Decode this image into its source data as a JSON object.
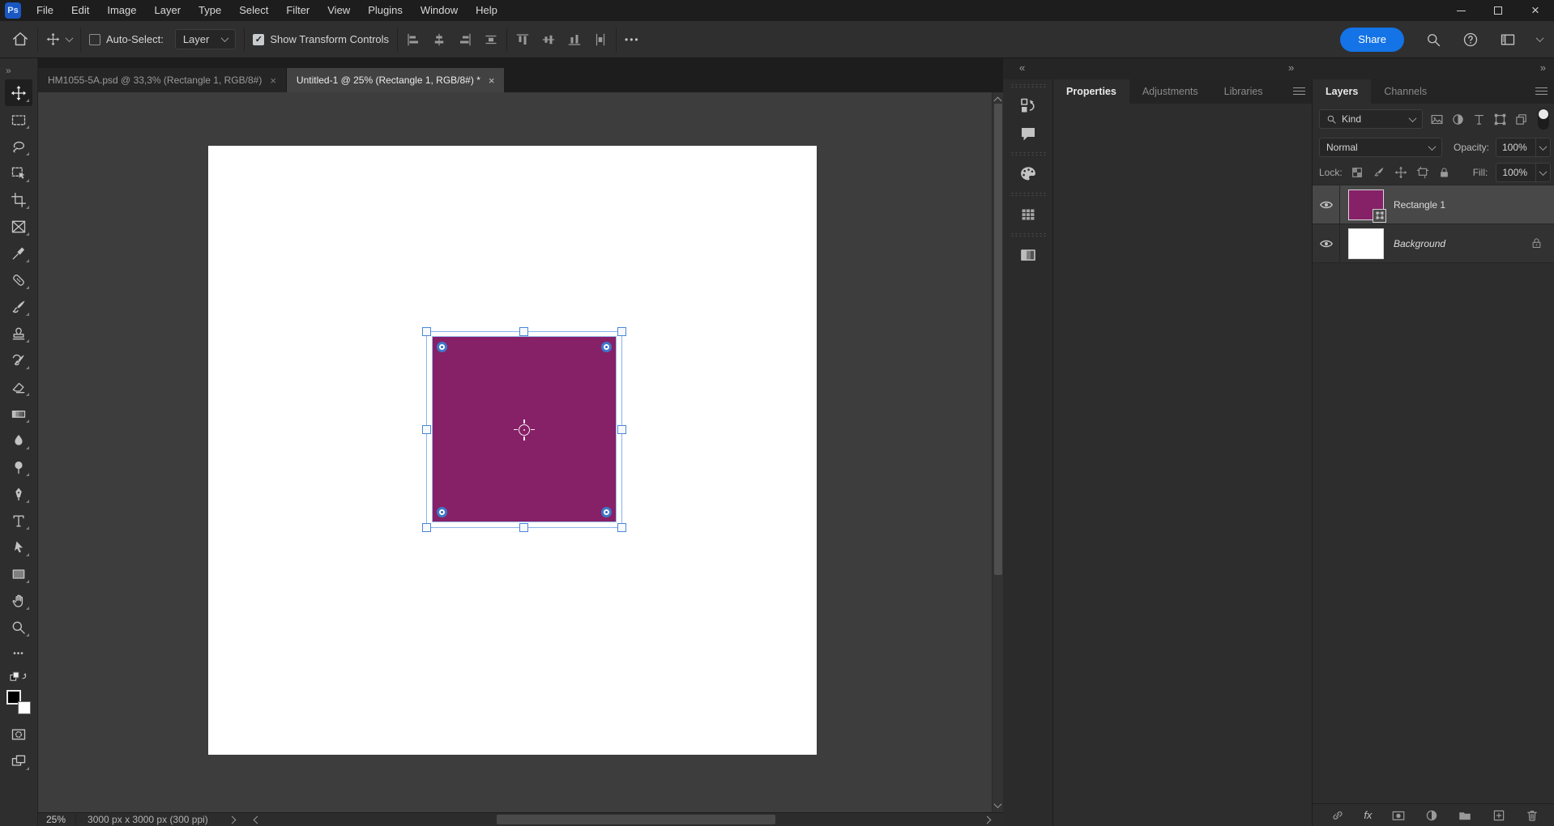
{
  "colors": {
    "accent_blue": "#1473e6",
    "selection_blue": "#4a86d8",
    "shape_fill": "#862067",
    "canvas_surface": "#3d3d3d",
    "panel_background": "#2d2d2d"
  },
  "menubar": {
    "logo": "Ps",
    "items": [
      "File",
      "Edit",
      "Image",
      "Layer",
      "Type",
      "Select",
      "Filter",
      "View",
      "Plugins",
      "Window",
      "Help"
    ]
  },
  "window_controls": [
    "minimize",
    "maximize",
    "close"
  ],
  "options_bar": {
    "auto_select_label": "Auto-Select:",
    "auto_select_checked": false,
    "target_selector_value": "Layer",
    "show_transform_label": "Show Transform Controls",
    "show_transform_checked": true,
    "align_icons": [
      "align-left-edges",
      "align-horizontal-centers",
      "align-right-edges",
      "distribute-horizontal-centers",
      "align-top-edges",
      "align-vertical-centers",
      "align-bottom-edges",
      "distribute-vertical-centers"
    ],
    "share_label": "Share"
  },
  "document_tabs": [
    {
      "label": "HM1055-5A.psd @ 33,3% (Rectangle 1, RGB/8#)",
      "active": false
    },
    {
      "label": "Untitled-1 @ 25% (Rectangle 1, RGB/8#) *",
      "active": true
    }
  ],
  "toolbar_tools": [
    "move",
    "rectangular-marquee",
    "lasso",
    "object-selection",
    "crop",
    "frame",
    "eyedropper",
    "spot-healing-brush",
    "brush",
    "clone-stamp",
    "history-brush",
    "eraser",
    "gradient",
    "blur",
    "dodge",
    "pen",
    "type",
    "path-selection",
    "rectangle",
    "hand",
    "zoom",
    "more-tools",
    "swap-colors",
    "foreground-background-swatches",
    "quick-mask",
    "screen-mode"
  ],
  "collapsed_panel_icons": [
    "history",
    "comments",
    "color",
    "patterns",
    "gradients"
  ],
  "properties_group": {
    "tabs": [
      {
        "label": "Properties",
        "active": true
      },
      {
        "label": "Adjustments",
        "active": false
      },
      {
        "label": "Libraries",
        "active": false
      }
    ]
  },
  "layers_panel": {
    "tabs": [
      {
        "label": "Layers",
        "active": true
      },
      {
        "label": "Channels",
        "active": false
      }
    ],
    "kind_filter_label": "Kind",
    "filter_type_icons": [
      "pixel-layer-filter",
      "adjustment-layer-filter",
      "type-layer-filter",
      "shape-layer-filter",
      "smart-object-filter"
    ],
    "filter_toggle_on": true,
    "blend_mode": "Normal",
    "opacity_label": "Opacity:",
    "opacity_value": "100%",
    "lock_label": "Lock:",
    "lock_icons": [
      "lock-transparent-pixels",
      "lock-image-pixels",
      "lock-position",
      "lock-artboard",
      "lock-all"
    ],
    "fill_label": "Fill:",
    "fill_value": "100%",
    "layers": [
      {
        "name": "Rectangle 1",
        "kind": "shape",
        "visible": true,
        "selected": true,
        "locked": false
      },
      {
        "name": "Background",
        "kind": "background",
        "visible": true,
        "selected": false,
        "locked": true
      }
    ],
    "footer_icons": [
      "link-layers",
      "layer-styles",
      "add-layer-mask",
      "new-adjustment-layer",
      "new-group",
      "new-layer",
      "delete-layer"
    ]
  },
  "status_bar": {
    "zoom_value": "25%",
    "document_info": "3000 px x 3000 px (300 ppi)"
  }
}
